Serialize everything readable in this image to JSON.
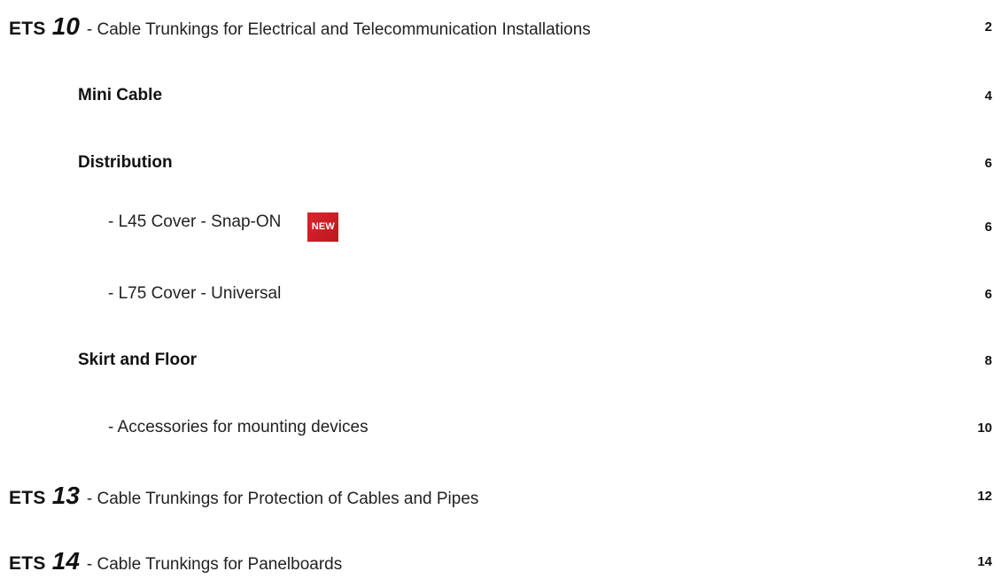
{
  "toc": {
    "entries": [
      {
        "brand": "ETS",
        "number": "10",
        "label": "- Cable Trunkings for Electrical and Telecommunication Installations",
        "page": "2"
      },
      {
        "label": "Mini Cable",
        "page": "4"
      },
      {
        "label": "Distribution",
        "page": "6"
      },
      {
        "label": "- L45 Cover - Snap-ON",
        "badge": "NEW",
        "page": "6"
      },
      {
        "label": "- L75 Cover - Universal",
        "page": "6"
      },
      {
        "label": "Skirt and Floor",
        "page": "8"
      },
      {
        "label": "- Accessories for mounting devices",
        "page": "10"
      },
      {
        "brand": "ETS",
        "number": "13",
        "label": "- Cable Trunkings for Protection of Cables and Pipes",
        "page": "12"
      },
      {
        "brand": "ETS",
        "number": "14",
        "label": "- Cable Trunkings for Panelboards",
        "page": "14"
      }
    ]
  },
  "colors": {
    "badge": "#d8262e",
    "text": "#1a1a1a"
  }
}
